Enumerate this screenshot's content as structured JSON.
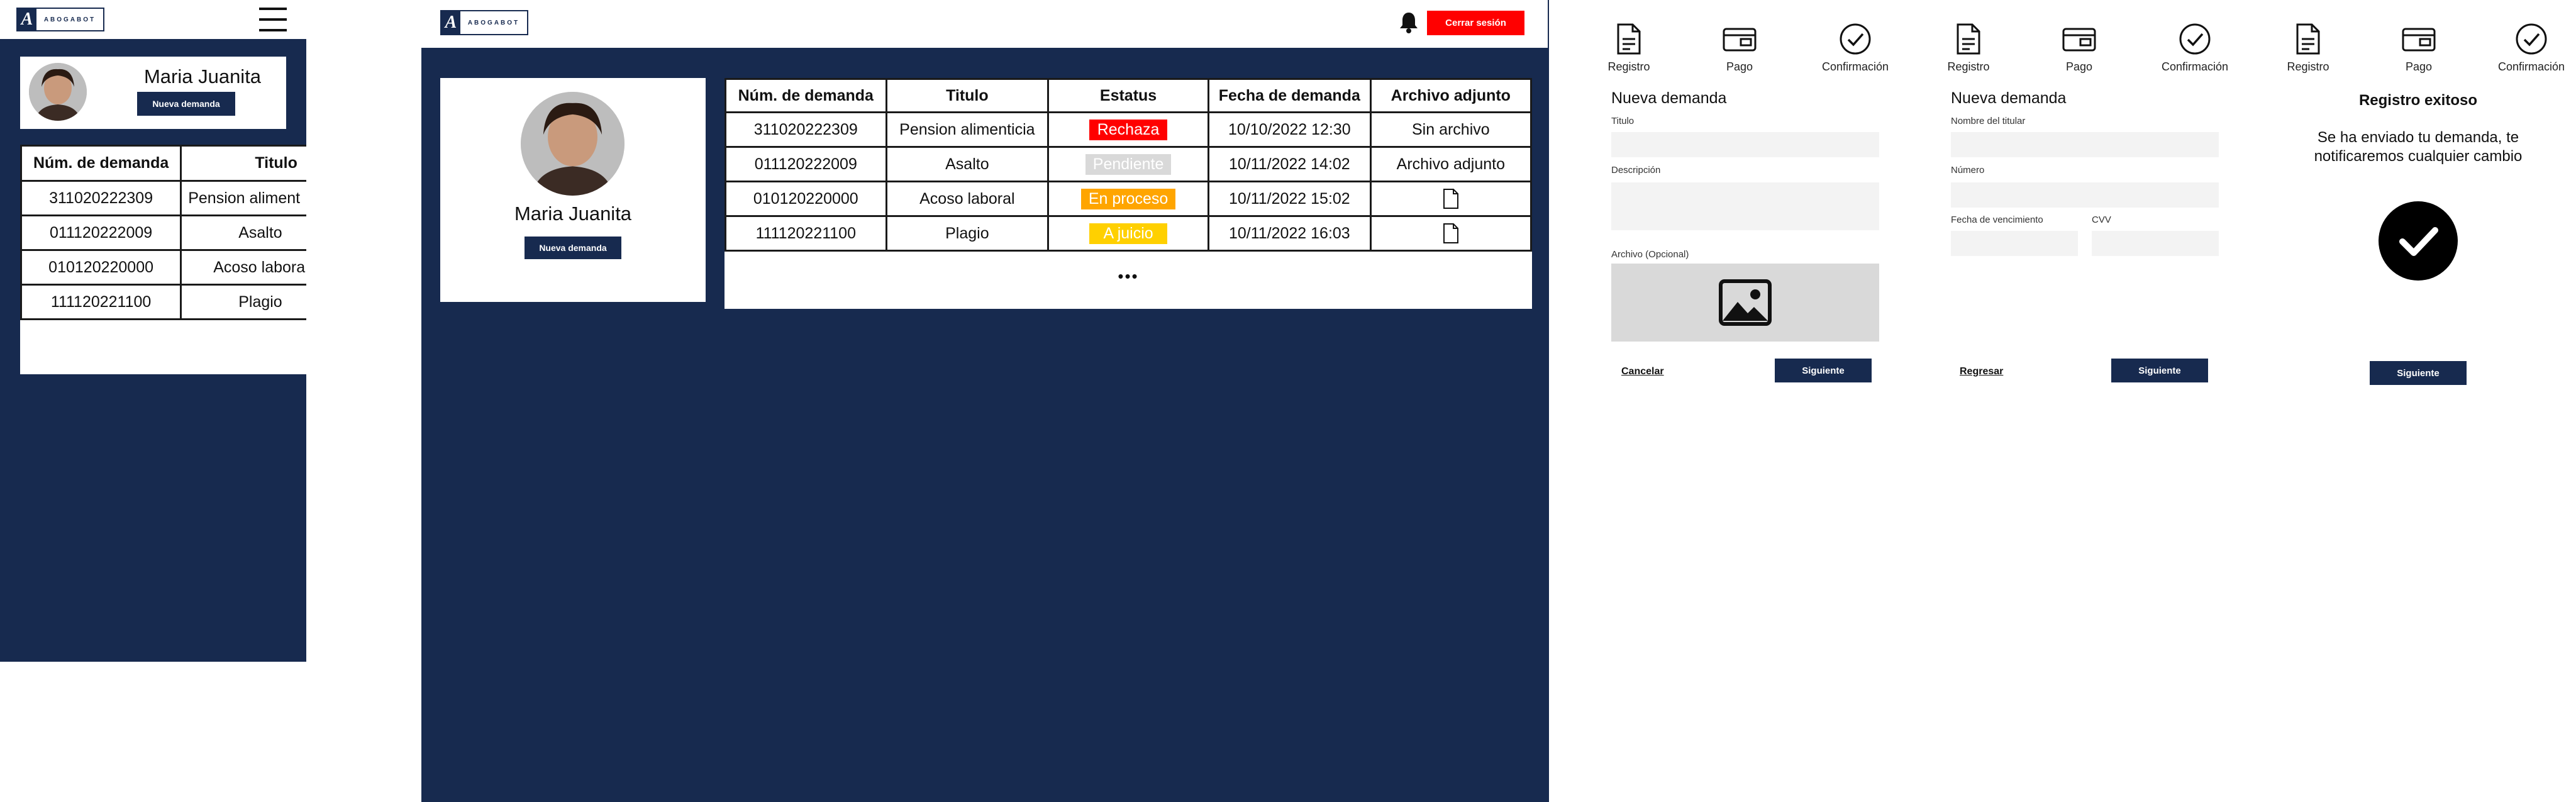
{
  "brand": {
    "mark": "A",
    "name": "ABOGABOT"
  },
  "user": {
    "name": "Maria Juanita",
    "new_demand_label": "Nueva demanda"
  },
  "header": {
    "logout_label": "Cerrar sesión"
  },
  "table": {
    "headers": [
      "Núm. de demanda",
      "Titulo",
      "Estatus",
      "Fecha de demanda",
      "Archivo adjunto"
    ],
    "rows": [
      {
        "num": "311020222309",
        "title": "Pension alimenticia",
        "status": "Rechaza",
        "date": "10/10/2022 12:30",
        "file": "Sin archivo"
      },
      {
        "num": "011120222009",
        "title": "Asalto",
        "status": "Pendiente",
        "date": "10/11/2022 14:02",
        "file": "Archivo adjunto"
      },
      {
        "num": "010120220000",
        "title": "Acoso laboral",
        "status": "En proceso",
        "date": "10/11/2022 15:02",
        "file": "file-icon"
      },
      {
        "num": "111120221100",
        "title": "Plagio",
        "status": "A juicio",
        "date": "10/11/2022 16:03",
        "file": "file-icon"
      }
    ],
    "more": "•••"
  },
  "mobile_table": {
    "rows": [
      {
        "num": "311020222309",
        "title": "Pension aliment"
      },
      {
        "num": "011120222009",
        "title": "Asalto"
      },
      {
        "num": "010120220000",
        "title": "Acoso labora"
      },
      {
        "num": "111120221100",
        "title": "Plagio"
      }
    ]
  },
  "status_colors": {
    "Rechaza": "#ff0000",
    "Pendiente": "#d9d9d9",
    "En proceso": "#ffa500",
    "A juicio": "#ffd000"
  },
  "colors": {
    "navy": "#172a4f",
    "danger": "#ff0000"
  },
  "steps": {
    "registro": "Registro",
    "pago": "Pago",
    "confirmacion": "Confirmación"
  },
  "form1": {
    "heading": "Nueva demanda",
    "title_label": "Titulo",
    "description_label": "Descripción",
    "file_label": "Archivo (Opcional)",
    "cancel_label": "Cancelar",
    "next_label": "Siguiente"
  },
  "form2": {
    "heading": "Nueva demanda",
    "holder_label": "Nombre del titular",
    "number_label": "Número",
    "expiry_label": "Fecha de vencimiento",
    "cvv_label": "CVV",
    "back_label": "Regresar",
    "next_label": "Siguiente"
  },
  "form3": {
    "heading": "Registro exitoso",
    "message": "Se ha enviado tu demanda, te notificaremos cualquier cambio",
    "next_label": "Siguiente"
  }
}
